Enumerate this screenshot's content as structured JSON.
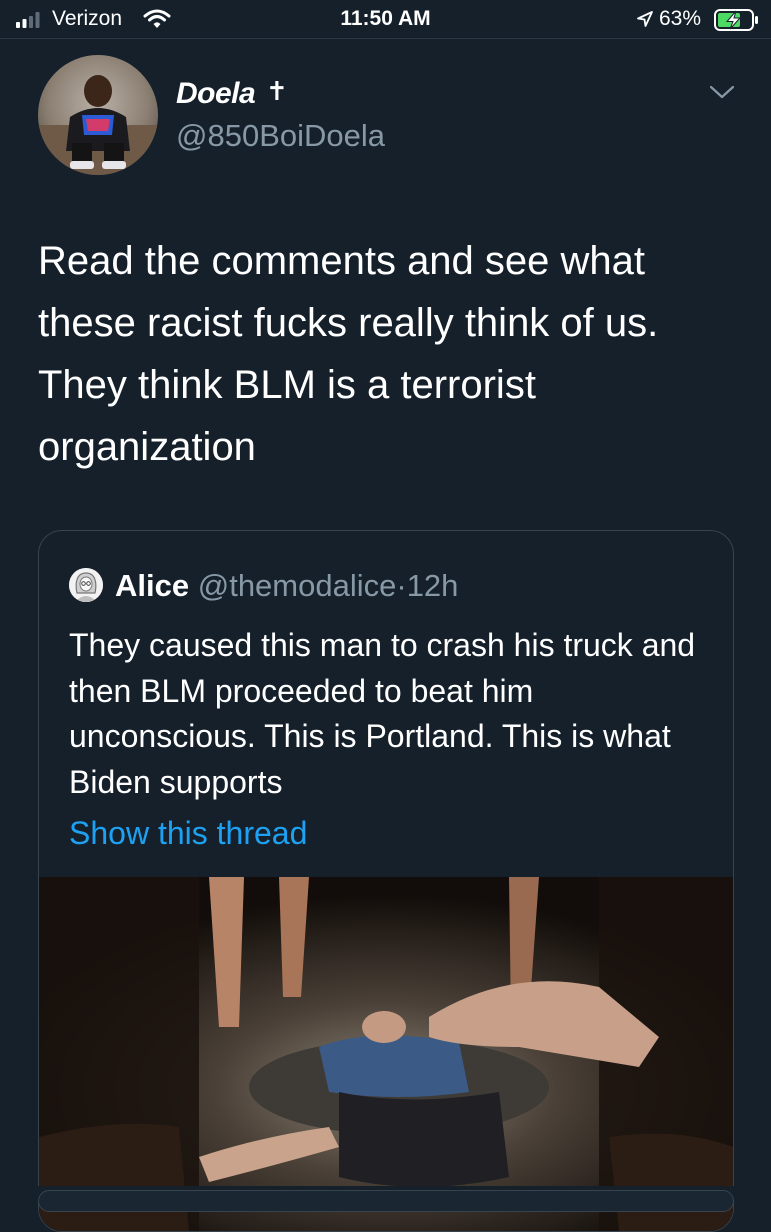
{
  "status_bar": {
    "carrier": "Verizon",
    "time": "11:50 AM",
    "battery_percent": "63%",
    "signal_icon": "cellular-signal-icon",
    "wifi_icon": "wifi-icon",
    "location_icon": "location-arrow-icon",
    "battery_icon": "battery-charging-icon"
  },
  "tweet": {
    "display_name": "Doela",
    "name_symbol": "✝",
    "handle": "@850BoiDoela",
    "text": "Read the comments and see what these racist fucks really think of us. They think BLM is a terrorist organization",
    "menu_icon": "chevron-down-icon"
  },
  "quoted_tweet": {
    "name": "Alice",
    "handle": "@themodalice",
    "separator": "·",
    "time": "12h",
    "text": "They caused this man to crash his truck and then BLM proceeded to beat him unconscious. This is Portland. This is what Biden supports",
    "show_thread": "Show this thread"
  },
  "colors": {
    "background": "#15202b",
    "secondary_text": "#8899a6",
    "link": "#1da1f2",
    "border": "#38444d",
    "battery_charge": "#4cd964"
  }
}
